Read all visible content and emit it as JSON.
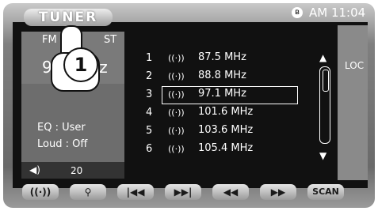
{
  "header": {
    "brand": "TUNER",
    "clock": "AM 11:04",
    "bluetooth_icon": "bluetooth-icon"
  },
  "tuner": {
    "band": "FM",
    "stereo": "ST",
    "frequency_visible": "97.",
    "frequency_suffix": "Hz"
  },
  "settings": {
    "eq": "EQ   : User",
    "loud": "Loud : Off"
  },
  "volume": {
    "value": "20",
    "icon": "speaker-icon"
  },
  "presets": [
    {
      "num": "1",
      "freq": "87.5 MHz"
    },
    {
      "num": "2",
      "freq": "88.8 MHz"
    },
    {
      "num": "3",
      "freq": "97.1 MHz",
      "selected": true
    },
    {
      "num": "4",
      "freq": "101.6 MHz"
    },
    {
      "num": "5",
      "freq": "103.6 MHz"
    },
    {
      "num": "6",
      "freq": "105.4 MHz"
    }
  ],
  "side": {
    "loc": "LOC"
  },
  "annotation": {
    "step": "1"
  },
  "bottom_buttons": [
    {
      "icon": "antenna-icon"
    },
    {
      "icon": "search-icon"
    },
    {
      "icon": "skip-back-icon",
      "label": "|◀◀"
    },
    {
      "icon": "skip-forward-icon",
      "label": "▶▶|"
    },
    {
      "icon": "rewind-icon",
      "label": "◀◀"
    },
    {
      "icon": "fast-forward-icon",
      "label": "▶▶"
    },
    {
      "label": "SCAN"
    }
  ]
}
